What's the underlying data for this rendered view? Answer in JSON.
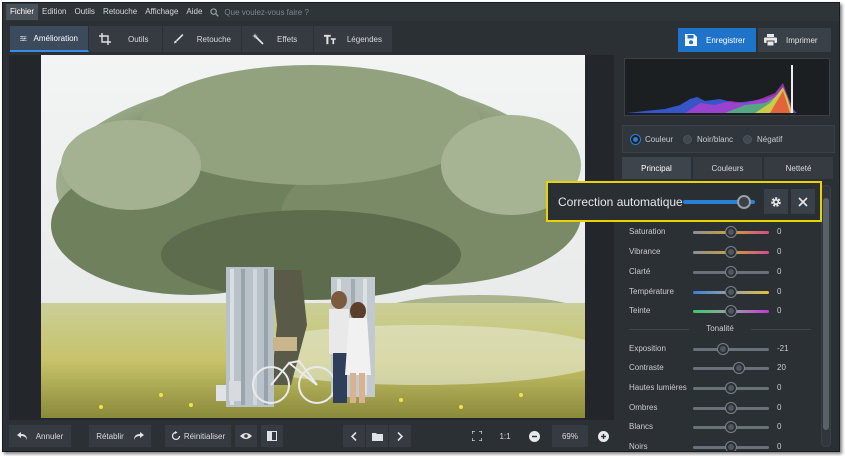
{
  "menu": {
    "items": [
      "Fichier",
      "Edition",
      "Outils",
      "Retouche",
      "Affichage",
      "Aide"
    ],
    "search_placeholder": "Que voulez-vous faire ?"
  },
  "toolbar": {
    "tabs": [
      "Amélioration",
      "Outils",
      "Retouche",
      "Effets",
      "Légendes"
    ],
    "save_label": "Enregistrer",
    "print_label": "Imprimer"
  },
  "bottom": {
    "undo_label": "Annuler",
    "redo_label": "Rétablir",
    "reset_label": "Réinitialiser",
    "ratio_label": "1:1",
    "zoom_value": "69%"
  },
  "panel": {
    "modes": [
      "Couleur",
      "Noir/blanc",
      "Négatif"
    ],
    "selected_mode": "Couleur",
    "subtabs": [
      "Principal",
      "Couleurs",
      "Netteté"
    ],
    "popup": {
      "label": "Correction automatique",
      "value_fraction": 0.85
    },
    "color_sliders": [
      {
        "label": "Saturation",
        "value": "0",
        "fraction": 0.5
      },
      {
        "label": "Vibrance",
        "value": "0",
        "fraction": 0.5
      },
      {
        "label": "Clarté",
        "value": "0",
        "fraction": 0.5
      },
      {
        "label": "Température",
        "value": "0",
        "fraction": 0.5
      },
      {
        "label": "Teinte",
        "value": "0",
        "fraction": 0.5
      }
    ],
    "tone_title": "Tonalité",
    "tone_sliders": [
      {
        "label": "Exposition",
        "value": "-21",
        "fraction": 0.39
      },
      {
        "label": "Contraste",
        "value": "20",
        "fraction": 0.6
      },
      {
        "label": "Hautes lumières",
        "value": "0",
        "fraction": 0.5
      },
      {
        "label": "Ombres",
        "value": "0",
        "fraction": 0.5
      },
      {
        "label": "Blancs",
        "value": "0",
        "fraction": 0.5
      },
      {
        "label": "Noirs",
        "value": "0",
        "fraction": 0.5
      }
    ]
  },
  "colors": {
    "accent": "#1f73c9",
    "popup_border": "#e8d200",
    "background": "#2b3035"
  }
}
